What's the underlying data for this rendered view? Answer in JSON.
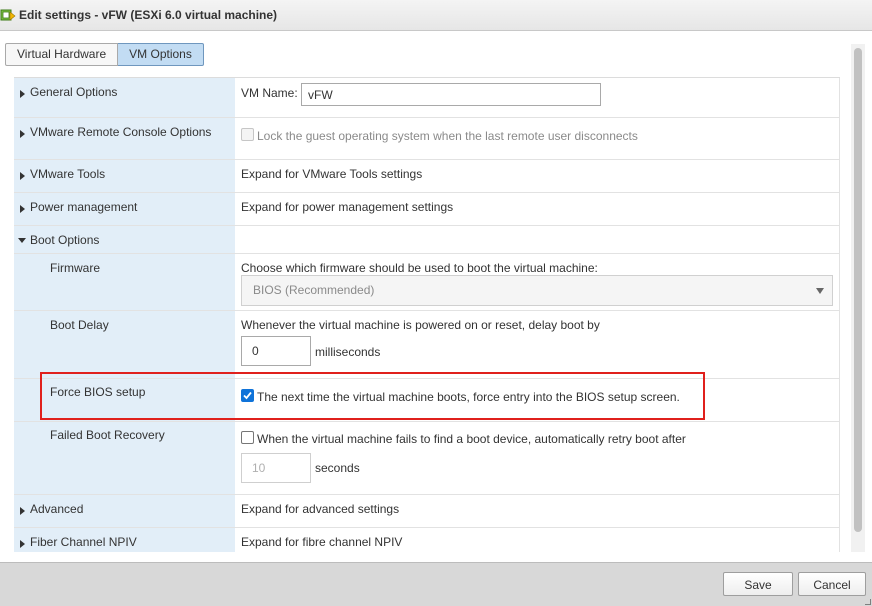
{
  "window": {
    "title": "Edit settings - vFW (ESXi 6.0 virtual machine)",
    "icon": "vm-edit-icon"
  },
  "tabs": [
    {
      "label": "Virtual Hardware",
      "active": false
    },
    {
      "label": "VM Options",
      "active": true
    }
  ],
  "general_options": {
    "label": "General Options",
    "vm_name_label": "VM Name:",
    "vm_name_value": "vFW"
  },
  "remote_console": {
    "label": "VMware Remote Console Options",
    "lock_text": "Lock the guest operating system when the last remote user disconnects",
    "lock_checked": false
  },
  "vmware_tools": {
    "label": "VMware Tools",
    "text": "Expand for VMware Tools settings"
  },
  "power_management": {
    "label": "Power management",
    "text": "Expand for power management settings"
  },
  "boot_options": {
    "label": "Boot Options",
    "firmware": {
      "label": "Firmware",
      "description": "Choose which firmware should be used to boot the virtual machine:",
      "selected": "BIOS (Recommended)"
    },
    "boot_delay": {
      "label": "Boot Delay",
      "description": "Whenever the virtual machine is powered on or reset, delay boot by",
      "value": "0",
      "unit": "milliseconds"
    },
    "force_bios": {
      "label": "Force BIOS setup",
      "text": "The next time the virtual machine boots, force entry into the BIOS setup screen.",
      "checked": true
    },
    "failed_boot_recovery": {
      "label": "Failed Boot Recovery",
      "text": "When the virtual machine fails to find a boot device, automatically retry boot after",
      "checked": false,
      "value": "10",
      "unit": "seconds"
    }
  },
  "advanced": {
    "label": "Advanced",
    "text": "Expand for advanced settings"
  },
  "fiber_channel": {
    "label": "Fiber Channel NPIV",
    "text": "Expand for fibre channel NPIV"
  },
  "footer": {
    "save_label": "Save",
    "cancel_label": "Cancel"
  },
  "colors": {
    "label_column": "#e2eef8",
    "active_tab": "#c2dcf3",
    "checkbox_checked": "#0f73d9",
    "highlight_border": "#e0201c",
    "footer": "#d8d8d8"
  }
}
